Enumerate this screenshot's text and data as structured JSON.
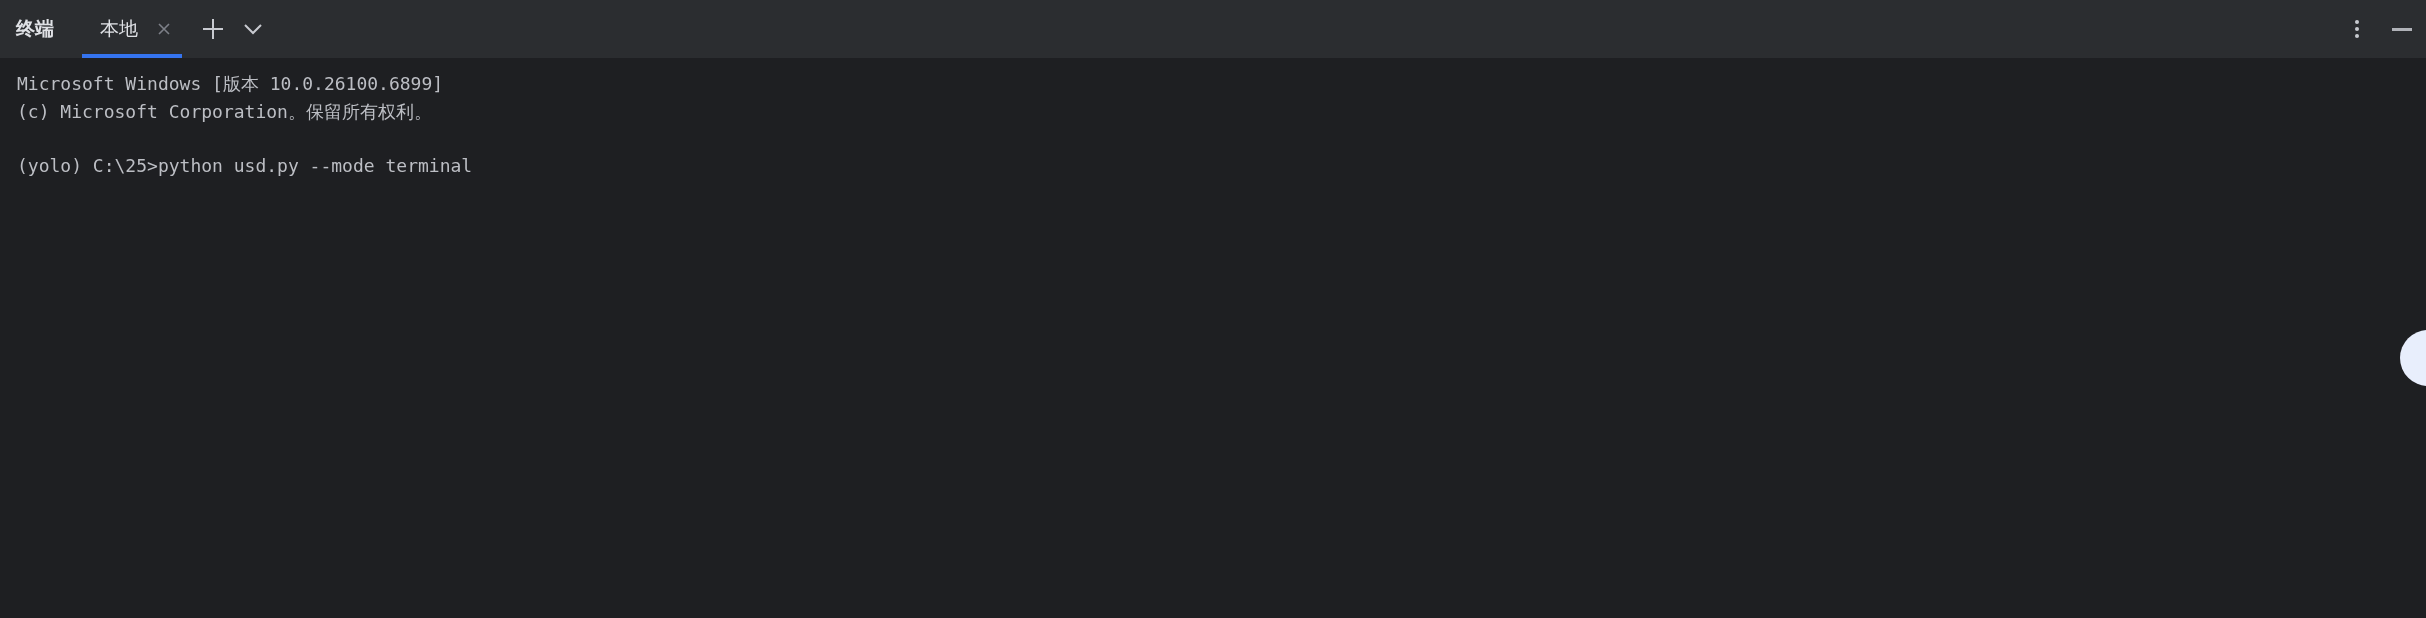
{
  "panel": {
    "title": "终端"
  },
  "tabs": [
    {
      "label": "本地",
      "selected": true
    }
  ],
  "terminal": {
    "blocks": [
      [
        "Microsoft Windows [版本 10.0.26100.6899]",
        "(c) Microsoft Corporation。保留所有权利。"
      ],
      [
        "(yolo) C:\\25>python usd.py --mode terminal"
      ]
    ]
  }
}
